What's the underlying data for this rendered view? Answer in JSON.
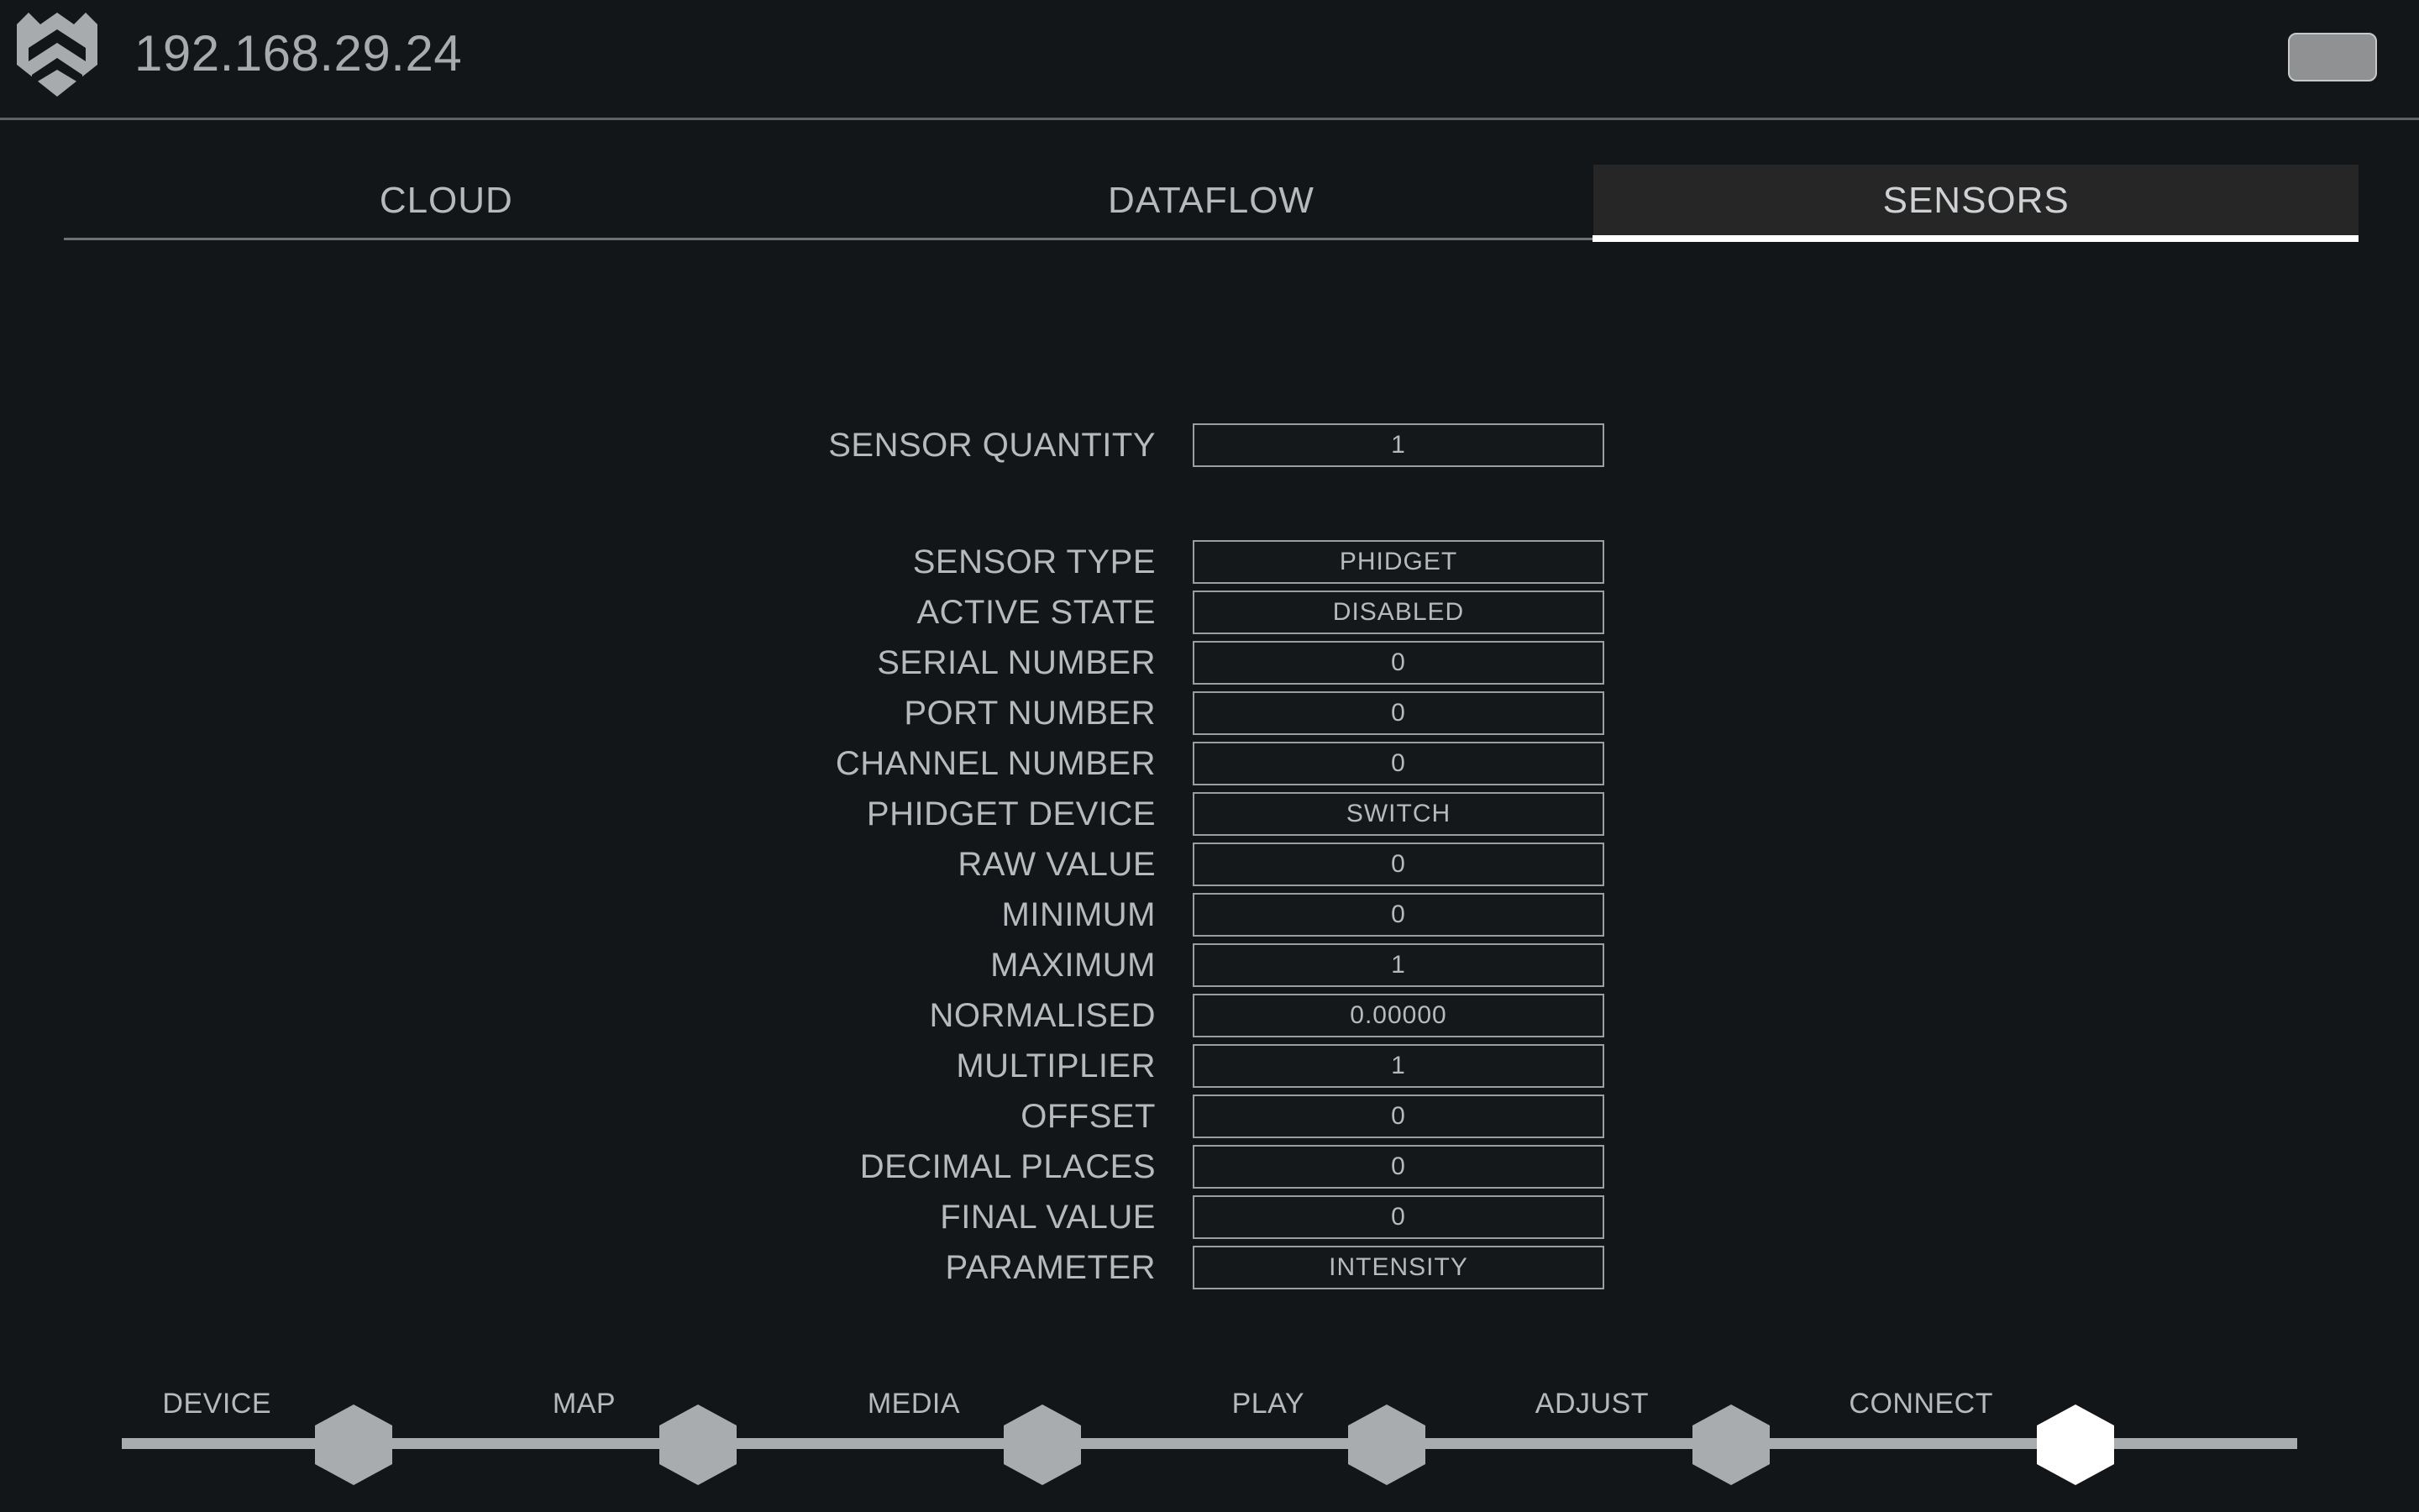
{
  "header": {
    "title": "192.168.29.24",
    "logo_icon": "shield-crest-logo",
    "button_label": "",
    "button_color": "#8f9193"
  },
  "tabs": [
    {
      "label": "CLOUD",
      "active": false
    },
    {
      "label": "DATAFLOW",
      "active": false
    },
    {
      "label": "SENSORS",
      "active": true
    }
  ],
  "form": {
    "quantity_row": {
      "label": "SENSOR QUANTITY",
      "value": "1"
    },
    "rows": [
      {
        "label": "SENSOR TYPE",
        "value": "PHIDGET"
      },
      {
        "label": "ACTIVE STATE",
        "value": "DISABLED"
      },
      {
        "label": "SERIAL NUMBER",
        "value": "0"
      },
      {
        "label": "PORT NUMBER",
        "value": "0"
      },
      {
        "label": "CHANNEL NUMBER",
        "value": "0"
      },
      {
        "label": "PHIDGET DEVICE",
        "value": "SWITCH"
      },
      {
        "label": "RAW VALUE",
        "value": "0"
      },
      {
        "label": "MINIMUM",
        "value": "0"
      },
      {
        "label": "MAXIMUM",
        "value": "1"
      },
      {
        "label": "NORMALISED",
        "value": "0.00000"
      },
      {
        "label": "MULTIPLIER",
        "value": "1"
      },
      {
        "label": "OFFSET",
        "value": "0"
      },
      {
        "label": "DECIMAL PLACES",
        "value": "0"
      },
      {
        "label": "FINAL VALUE",
        "value": "0"
      },
      {
        "label": "PARAMETER",
        "value": "INTENSITY"
      }
    ]
  },
  "bottom_nav": {
    "steps": [
      {
        "label": "DEVICE",
        "active": false
      },
      {
        "label": "MAP",
        "active": false
      },
      {
        "label": "MEDIA",
        "active": false
      },
      {
        "label": "PLAY",
        "active": false
      },
      {
        "label": "ADJUST",
        "active": false
      },
      {
        "label": "CONNECT",
        "active": true
      }
    ]
  },
  "colors": {
    "background": "#121619",
    "text": "#b6babd",
    "border": "#9a9ea1",
    "accent_active": "#ffffff",
    "rail": "#a9acae",
    "tab_active_bg": "#262626"
  }
}
